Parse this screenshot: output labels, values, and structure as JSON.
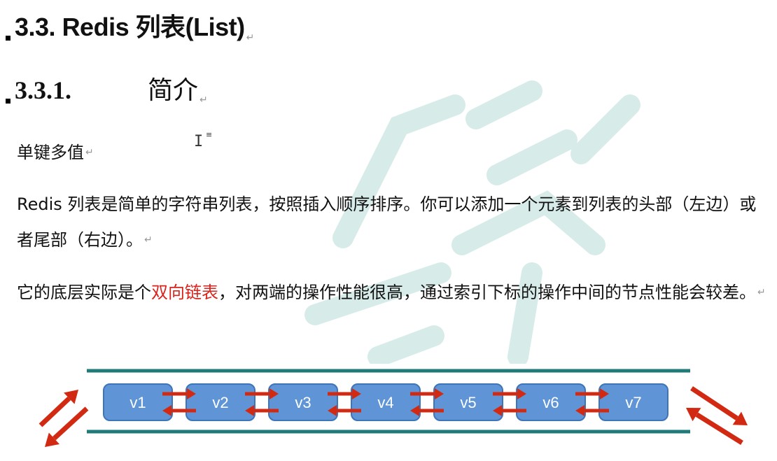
{
  "section": {
    "number": "3.3.",
    "title": "Redis 列表(List)"
  },
  "subsection": {
    "number": "3.3.1.",
    "title": "简介"
  },
  "paragraphs": {
    "p1": "单键多值",
    "p2": "Redis 列表是简单的字符串列表，按照插入顺序排序。你可以添加一个元素到列表的头部（左边）或者尾部（右边）。",
    "p3_before": "它的底层实际是个",
    "p3_highlight": "双向链表",
    "p3_after": "，对两端的操作性能很高，通过索引下标的操作中间的节点性能会较差。"
  },
  "paragraph_mark": "↵",
  "diagram": {
    "nodes": [
      "v1",
      "v2",
      "v3",
      "v4",
      "v5",
      "v6",
      "v7"
    ],
    "colors": {
      "rail": "#1f7a78",
      "node_fill": "#5f95d6",
      "node_stroke": "#3e74b8",
      "arrow": "#d22a12",
      "highlight_text": "#d9231c"
    }
  }
}
